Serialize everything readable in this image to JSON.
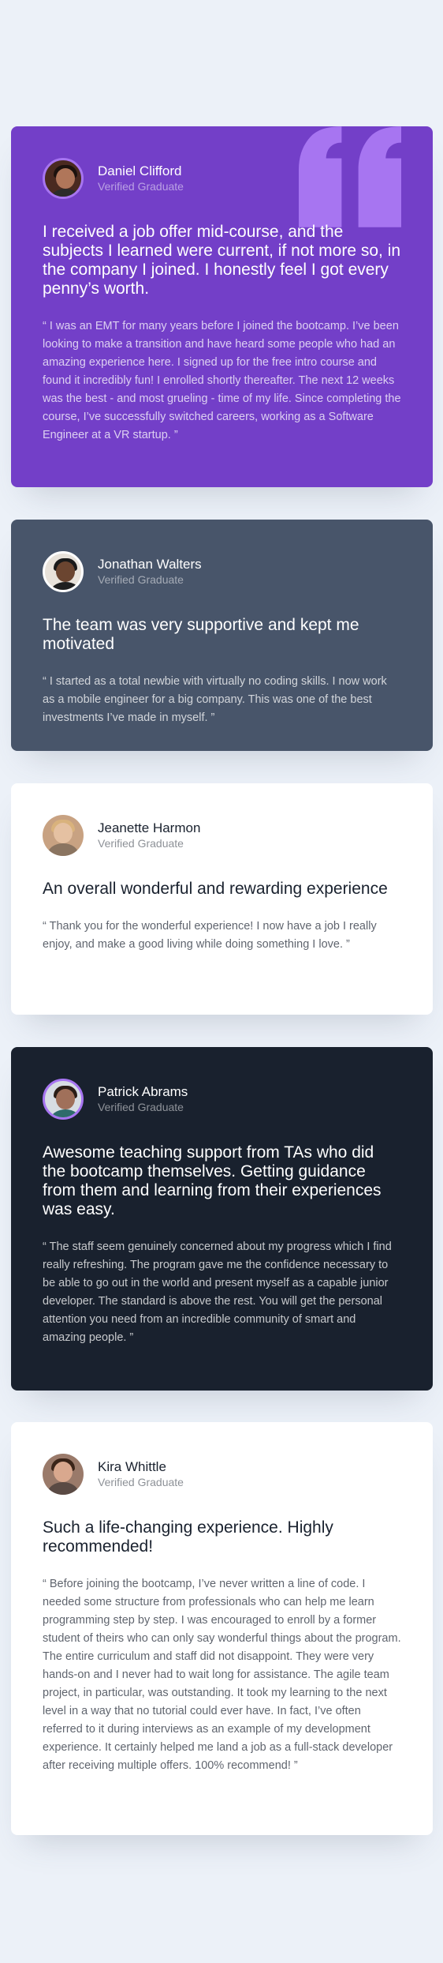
{
  "colors": {
    "page_background": "#ECF1F8",
    "moderate_violet": "#733FC8",
    "grayish_blue": "#48556A",
    "white": "#FFFFFF",
    "very_dark_blackish_blue": "#19212E",
    "quote_mark_violet": "#A775F1"
  },
  "testimonials": [
    {
      "name": "Daniel Clifford",
      "role": "Verified Graduate",
      "headline": "I received a job offer mid-course, and the subjects I learned were current, if not more so, in the company I joined. I honestly feel I got every penny’s worth.",
      "quote": "“ I was an EMT for many years before I joined the bootcamp. I’ve been looking to make a transition and have heard some people who had an amazing experience here. I signed up for the free intro course and found it incredibly fun! I enrolled shortly thereafter. The next 12 weeks was the best - and most grueling - time of my life. Since completing the course, I’ve successfully switched careers, working as a Software Engineer at a VR startup. ”",
      "icon": "quotation-mark-icon"
    },
    {
      "name": "Jonathan Walters",
      "role": "Verified Graduate",
      "headline": "The team was very supportive and kept me motivated",
      "quote": "“ I started as a total newbie with virtually no coding skills. I now work as a mobile engineer for a big company. This was one of the best investments I’ve made in myself. ”"
    },
    {
      "name": "Jeanette Harmon",
      "role": "Verified Graduate",
      "headline": "An overall wonderful and rewarding experience",
      "quote": "“ Thank you for the wonderful experience! I now have a job I really enjoy, and make a good living while doing something I love. ”"
    },
    {
      "name": "Patrick Abrams",
      "role": "Verified Graduate",
      "headline": "Awesome teaching support from TAs who did the bootcamp themselves. Getting guidance from them and learning from their experiences was easy.",
      "quote": "“ The staff seem genuinely concerned about my progress which I find really refreshing. The program gave me the confidence necessary to be able to go out in the world and present myself as a capable junior developer. The standard is above the rest. You will get the personal attention you need from an incredible community of smart and amazing people. ”"
    },
    {
      "name": "Kira Whittle",
      "role": "Verified Graduate",
      "headline": "Such a life-changing experience. Highly recommended!",
      "quote": "“ Before joining the bootcamp, I’ve never written a line of code. I needed some structure from professionals who can help me learn programming step by step. I was encouraged to enroll by a former student of theirs who can only say wonderful things about the program. The entire curriculum and staff did not disappoint. They were very hands-on and I never had to wait long for assistance. The agile team project, in particular, was outstanding. It took my learning to the next level in a way that no tutorial could ever have. In fact, I’ve often referred to it during interviews as an example of my development experience. It certainly helped me land a job as a full-stack developer after receiving multiple offers. 100% recommend! ”"
    }
  ]
}
